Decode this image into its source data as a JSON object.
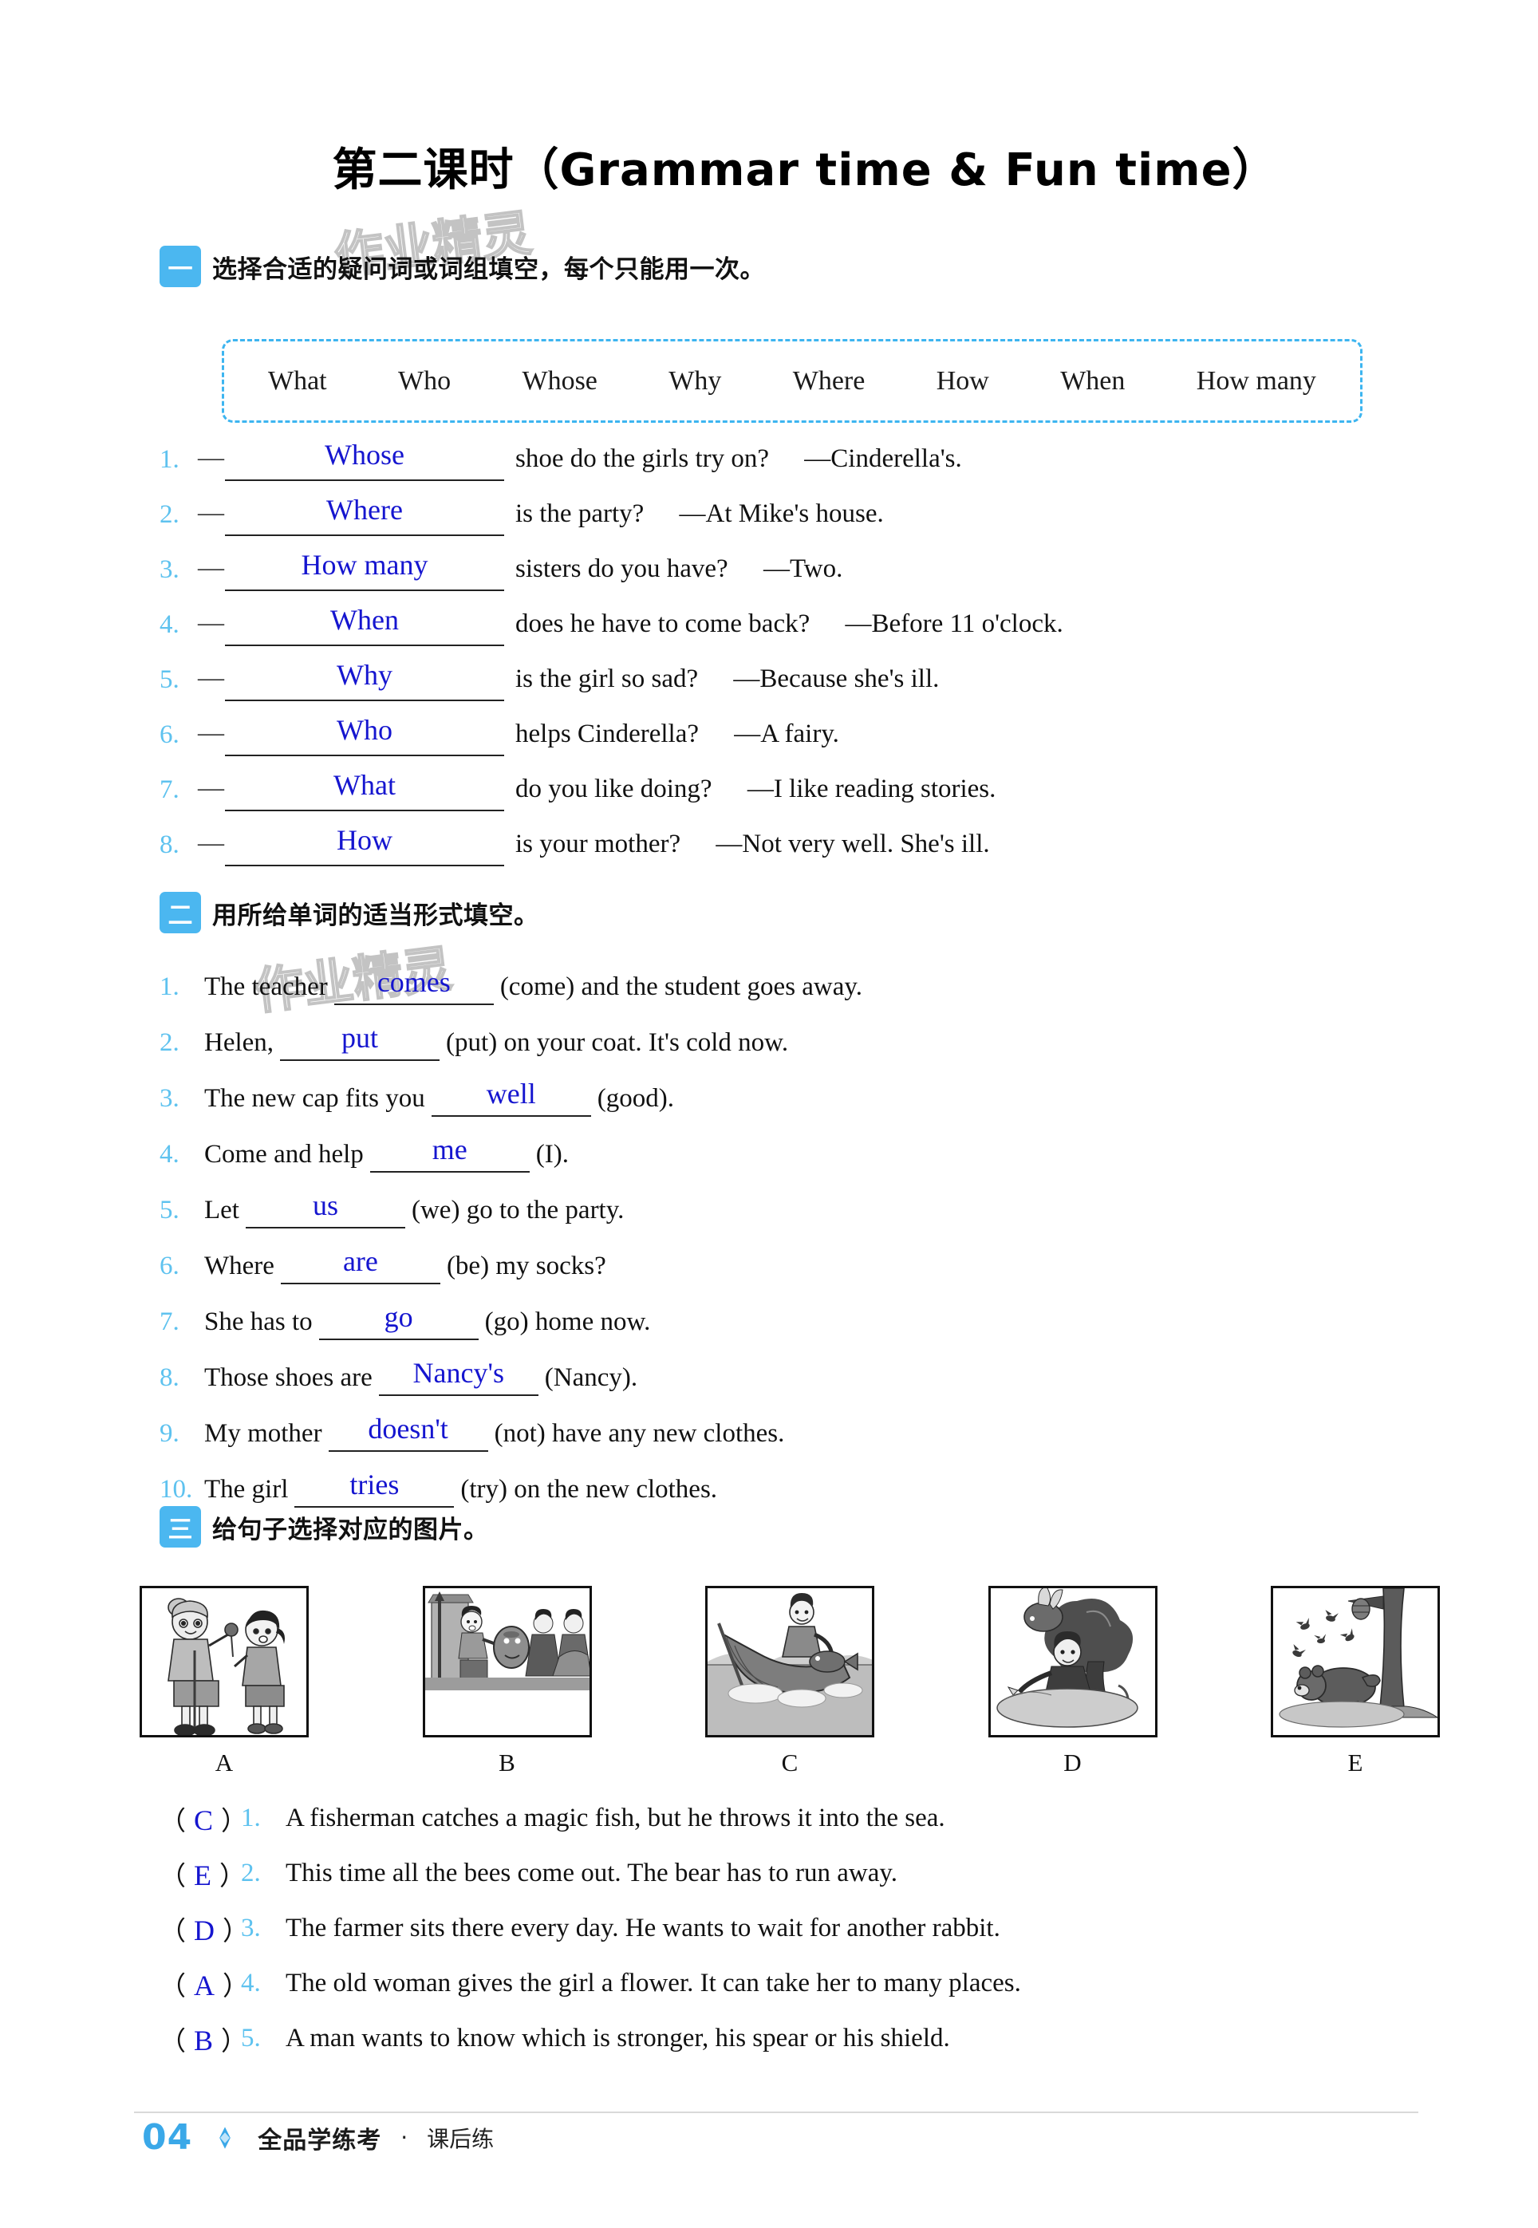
{
  "page": {
    "title": "第二课时（Grammar time & Fun time）",
    "watermark": "作业精灵",
    "footer": {
      "page_number": "04",
      "brand": "全品学练考",
      "separator": "·",
      "sub": "课后练"
    }
  },
  "section1": {
    "number": "一",
    "heading": "选择合适的疑问词或词组填空，每个只能用一次。",
    "word_bank": [
      "What",
      "Who",
      "Whose",
      "Why",
      "Where",
      "How",
      "When",
      "How many"
    ],
    "items": [
      {
        "num": "1.",
        "answer": "Whose",
        "tail": "shoe do the girls try on?",
        "reply": "—Cinderella's."
      },
      {
        "num": "2.",
        "answer": "Where",
        "tail": "is the party?",
        "reply": "—At Mike's house."
      },
      {
        "num": "3.",
        "answer": "How many",
        "tail": "sisters do you have?",
        "reply": "—Two."
      },
      {
        "num": "4.",
        "answer": "When",
        "tail": "does he have to come back?",
        "reply": "—Before 11 o'clock."
      },
      {
        "num": "5.",
        "answer": "Why",
        "tail": "is the girl so sad?",
        "reply": "—Because she's ill."
      },
      {
        "num": "6.",
        "answer": "Who",
        "tail": "helps Cinderella?",
        "reply": "—A fairy."
      },
      {
        "num": "7.",
        "answer": "What",
        "tail": "do you like doing?",
        "reply": "—I like reading stories."
      },
      {
        "num": "8.",
        "answer": "How",
        "tail": "is your mother?",
        "reply": "—Not very well. She's ill."
      }
    ]
  },
  "section2": {
    "number": "二",
    "heading": "用所给单词的适当形式填空。",
    "items": [
      {
        "num": "1.",
        "pre": "The teacher",
        "answer": "comes",
        "post": "(come) and the student goes away."
      },
      {
        "num": "2.",
        "pre": "Helen,",
        "answer": "put",
        "post": "(put) on your coat. It's cold now."
      },
      {
        "num": "3.",
        "pre": "The new cap fits you",
        "answer": "well",
        "post": "(good)."
      },
      {
        "num": "4.",
        "pre": "Come and help",
        "answer": "me",
        "post": "(I)."
      },
      {
        "num": "5.",
        "pre": "Let",
        "answer": "us",
        "post": "(we) go to the party."
      },
      {
        "num": "6.",
        "pre": "Where",
        "answer": "are",
        "post": "(be) my socks?"
      },
      {
        "num": "7.",
        "pre": "She has to",
        "answer": "go",
        "post": "(go) home now."
      },
      {
        "num": "8.",
        "pre": "Those shoes are",
        "answer": "Nancy's",
        "post": "(Nancy)."
      },
      {
        "num": "9.",
        "pre": "My mother",
        "answer": "doesn't",
        "post": "(not) have any new clothes."
      },
      {
        "num": "10.",
        "pre": "The girl",
        "answer": "tries",
        "post": "(try) on the new clothes."
      }
    ]
  },
  "section3": {
    "number": "三",
    "heading": "给句子选择对应的图片。",
    "pictures": [
      {
        "label": "A",
        "desc": "old-woman-gives-flower-to-girl"
      },
      {
        "label": "B",
        "desc": "man-with-spear-and-shield"
      },
      {
        "label": "C",
        "desc": "fisherman-in-boat-with-fish"
      },
      {
        "label": "D",
        "desc": "farmer-waiting-by-tree-with-rabbit"
      },
      {
        "label": "E",
        "desc": "bear-running-from-bees-and-beehive"
      }
    ],
    "items": [
      {
        "pick": "C",
        "num": "1.",
        "sentence": "A fisherman catches a magic fish, but he throws it into the sea."
      },
      {
        "pick": "E",
        "num": "2.",
        "sentence": "This time all the bees come out. The bear has to run away."
      },
      {
        "pick": "D",
        "num": "3.",
        "sentence": "The farmer sits there every day. He wants to wait for another rabbit."
      },
      {
        "pick": "A",
        "num": "4.",
        "sentence": "The old woman gives the girl a flower. It can take her to many places."
      },
      {
        "pick": "B",
        "num": "5.",
        "sentence": "A man wants to know which is stronger, his spear or his shield."
      }
    ]
  },
  "colors": {
    "accent": "#4bb7f0",
    "answer_ink": "#1515cf",
    "number_ink": "#5ec2ef"
  }
}
